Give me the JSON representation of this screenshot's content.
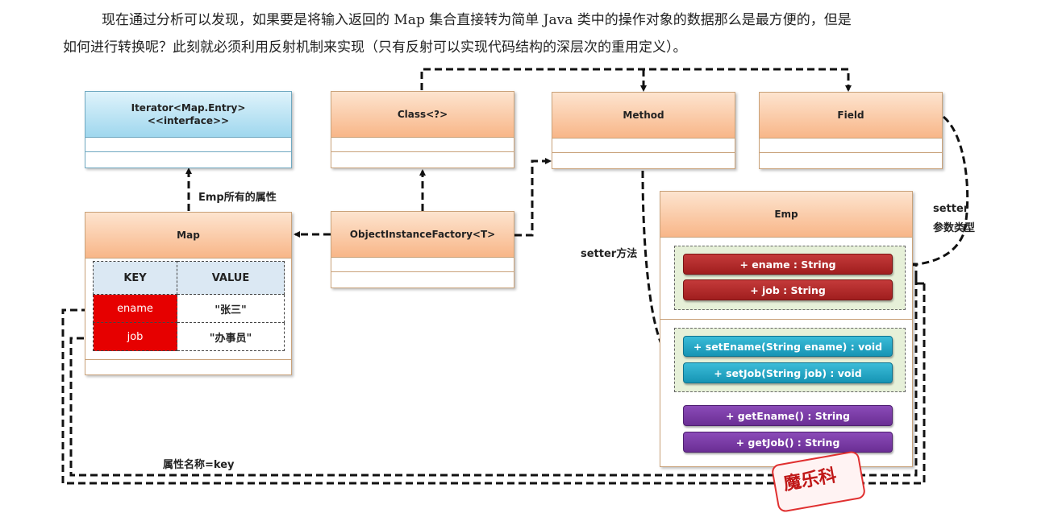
{
  "paragraph": {
    "line1": "现在通过分析可以发现，如果要是将输入返回的 Map 集合直接转为简单 Java 类中的操作对象的数据那么是最方便的，但是",
    "line2": "如何进行转换呢？此刻就必须利用反射机制来实现（只有反射可以实现代码结构的深层次的重用定义）。"
  },
  "boxes": {
    "iterator": {
      "line1": "Iterator<Map.Entry>",
      "line2": "<<interface>>"
    },
    "class": "Class<?>",
    "method": "Method",
    "field": "Field",
    "map": "Map",
    "factory": "ObjectInstanceFactory<T>",
    "emp": "Emp"
  },
  "map_table": {
    "headers": [
      "KEY",
      "VALUE"
    ],
    "rows": [
      {
        "key": "ename",
        "value": "\"张三\""
      },
      {
        "key": "job",
        "value": "\"办事员\""
      }
    ]
  },
  "emp": {
    "fields": [
      "+ ename : String",
      "+ job : String"
    ],
    "setters": [
      "+ setEname(String ename) : void",
      "+ setJob(String job) : void"
    ],
    "getters": [
      "+ getEname() : String",
      "+ getJob() : String"
    ]
  },
  "labels": {
    "emp_attrs": "Emp所有的属性",
    "setter_method": "setter方法",
    "setter_line1": "setter",
    "setter_line2": "参数类型",
    "attr_name_key": "属性名称=key"
  },
  "stamp": "魔乐科",
  "colors": {
    "orange_header": "#f8b688",
    "blue_header": "#9fd7ee",
    "red_key": "#e60000",
    "field_pill": "#a01e1e",
    "setter_pill": "#1694b4",
    "getter_pill": "#6a2e94"
  }
}
